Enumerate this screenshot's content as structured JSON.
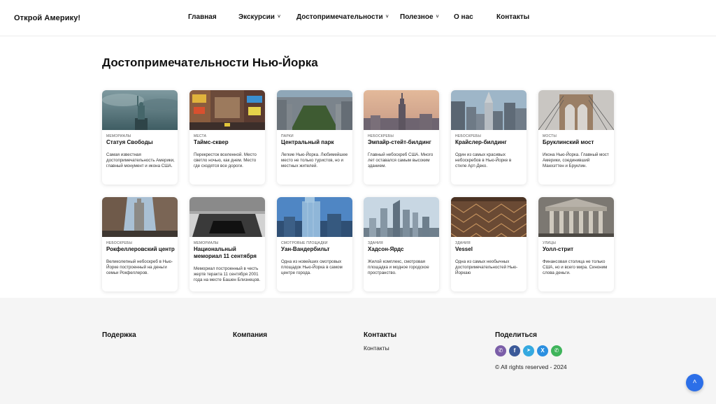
{
  "header": {
    "logo": "Открой Америку!",
    "nav": [
      {
        "label": "Главная",
        "dropdown": false
      },
      {
        "label": "Экскурсии",
        "dropdown": true
      },
      {
        "label": "Достопримечательности",
        "dropdown": true
      },
      {
        "label": "Полезное",
        "dropdown": true
      },
      {
        "label": "О нас",
        "dropdown": false
      },
      {
        "label": "Контакты",
        "dropdown": false
      }
    ],
    "chevron": "˅"
  },
  "main": {
    "title": "Достопримечательности Нью-Йорка",
    "cards": [
      {
        "category": "Мемориалы",
        "title": "Статуя Свободы",
        "description": "Самая известная достопримечательность Америки, главный монумент и икона США."
      },
      {
        "category": "Места",
        "title": "Таймс-сквер",
        "description": "Перекресток вселенной. Место светло ночью, как днем. Место где сходятся все дороги."
      },
      {
        "category": "Парки",
        "title": "Центральный парк",
        "description": "Легкие Нью-Йорка. Любимейшее место не только туристов, но и местных жителей."
      },
      {
        "category": "Небоскребы",
        "title": "Эмпайр-стейт-билдинг",
        "description": "Главный небоскреб США. Много лет оставался самым высоким зданием."
      },
      {
        "category": "Небоскребы",
        "title": "Крайслер-билдинг",
        "description": "Один из самых красивых небоскребов в Нью-Йорке в стиле Арт-Деко."
      },
      {
        "category": "Мосты",
        "title": "Бруклинский мост",
        "description": "Икона Нью-Йорка. Главный мост Америки, соединивший Манхэттен и Бруклин."
      },
      {
        "category": "Небоскребы",
        "title": "Рокфеллеровский центр",
        "description": "Великолепный небоскреб в Нью-Йорке построенный на деньги семьи Рокфеллеров."
      },
      {
        "category": "Мемориалы",
        "title": "Национальный мемориал 11 сентября",
        "description": "Мемориал построенный в честь жертв теракта 11 сентября 2001 года на месте Башен Близнецов."
      },
      {
        "category": "Смотровые площадки",
        "title": "Уан-Вандербильт",
        "description": "Одна из новейших смотровых площадок Нью-Йорка в самом центре города."
      },
      {
        "category": "Здания",
        "title": "Хадсон-Ярдс",
        "description": "Жилой комплекс, смотровая площадка и модное городское пространство."
      },
      {
        "category": "Здания",
        "title": "Vessel",
        "description": "Одна из самых необычных достопримечательностей Нью-Йоркаю"
      },
      {
        "category": "Улицы",
        "title": "Уолл-стрит",
        "description": "Финансовая столица не только США, но и всего мира. Синоним слова деньги."
      }
    ]
  },
  "footer": {
    "columns": [
      {
        "title": "Подержка"
      },
      {
        "title": "Компания"
      },
      {
        "title": "Контакты",
        "link": "Контакты"
      },
      {
        "title": "Поделиться"
      }
    ],
    "socials": [
      {
        "icon": "viber-icon",
        "glyph": "✆",
        "color": "#7b5ea8"
      },
      {
        "icon": "facebook-icon",
        "glyph": "f",
        "color": "#3b5998"
      },
      {
        "icon": "telegram-icon",
        "glyph": "➤",
        "color": "#35a9e0"
      },
      {
        "icon": "x-icon",
        "glyph": "X",
        "color": "#2b8fe0"
      },
      {
        "icon": "whatsapp-icon",
        "glyph": "✆",
        "color": "#3fb45b"
      }
    ],
    "copyright": "© All rights reserved - 2024"
  },
  "scroll_top": {
    "icon": "arrow-up-icon",
    "glyph": "˄"
  },
  "colors": {
    "accent": "#2c6fe8",
    "footer_bg": "#f5f5f5"
  }
}
